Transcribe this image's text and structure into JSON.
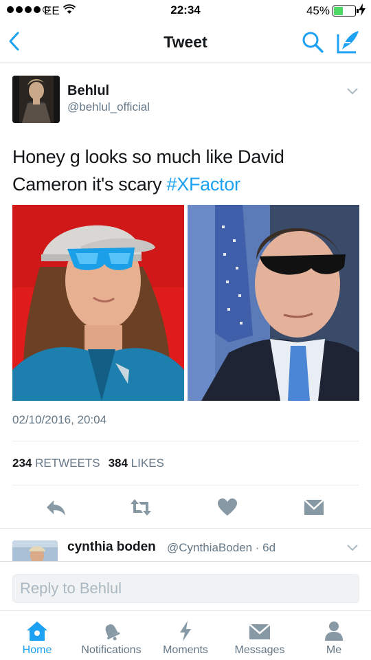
{
  "status_bar": {
    "carrier": "EE",
    "time": "22:34",
    "battery_percent": "45%",
    "battery_level": 0.45,
    "signal_bars_filled": 4
  },
  "nav": {
    "title": "Tweet",
    "back_icon": "chevron-left-icon",
    "search_icon": "search-icon",
    "compose_icon": "compose-icon"
  },
  "tweet": {
    "author_name": "Behlul",
    "author_handle": "@behlul_official",
    "text_before": "Honey g looks so much like David Cameron it's scary ",
    "hashtag": "#XFactor",
    "timestamp": "02/10/2016, 20:04",
    "retweet_count": "234",
    "retweet_label": "RETWEETS",
    "like_count": "384",
    "like_label": "LIKES"
  },
  "reply_preview": {
    "name": "cynthia boden",
    "handle": "@CynthiaBoden · 6d"
  },
  "reply_bar": {
    "placeholder": "Reply to Behlul"
  },
  "tabs": [
    {
      "label": "Home",
      "icon": "home-icon"
    },
    {
      "label": "Notifications",
      "icon": "bell-icon"
    },
    {
      "label": "Moments",
      "icon": "lightning-icon"
    },
    {
      "label": "Messages",
      "icon": "envelope-icon"
    },
    {
      "label": "Me",
      "icon": "person-icon"
    }
  ],
  "colors": {
    "accent": "#1da1f2",
    "secondary_text": "#657786",
    "icon_gray": "#8899a6"
  }
}
